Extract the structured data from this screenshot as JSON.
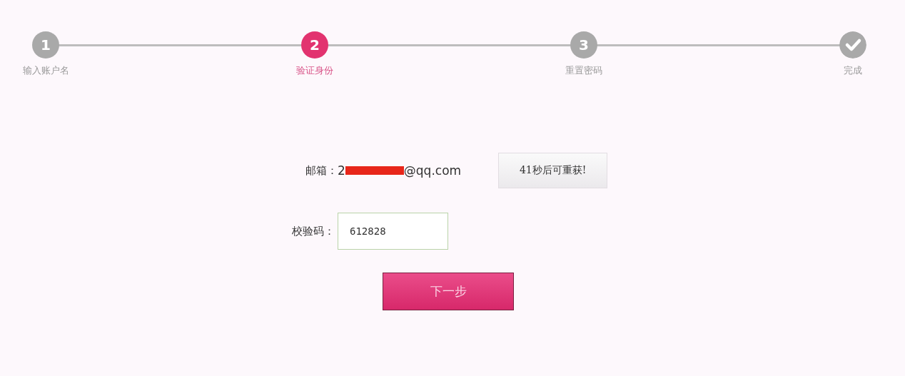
{
  "steps": [
    {
      "kind": "number",
      "number": "1",
      "label": "输入账户名",
      "selected": false
    },
    {
      "kind": "number",
      "number": "2",
      "label": "验证身份",
      "selected": true
    },
    {
      "kind": "number",
      "number": "3",
      "label": "重置密码",
      "selected": false
    },
    {
      "kind": "check",
      "label": "完成",
      "selected": false
    }
  ],
  "email": {
    "label": "邮箱：",
    "value_start": "2",
    "redacted": true,
    "value_end": "@qq.com"
  },
  "resend_button": {
    "label": "41秒后可重获!"
  },
  "code": {
    "label": "校验码：",
    "value": "612828"
  },
  "next_button": {
    "label": "下一步"
  }
}
